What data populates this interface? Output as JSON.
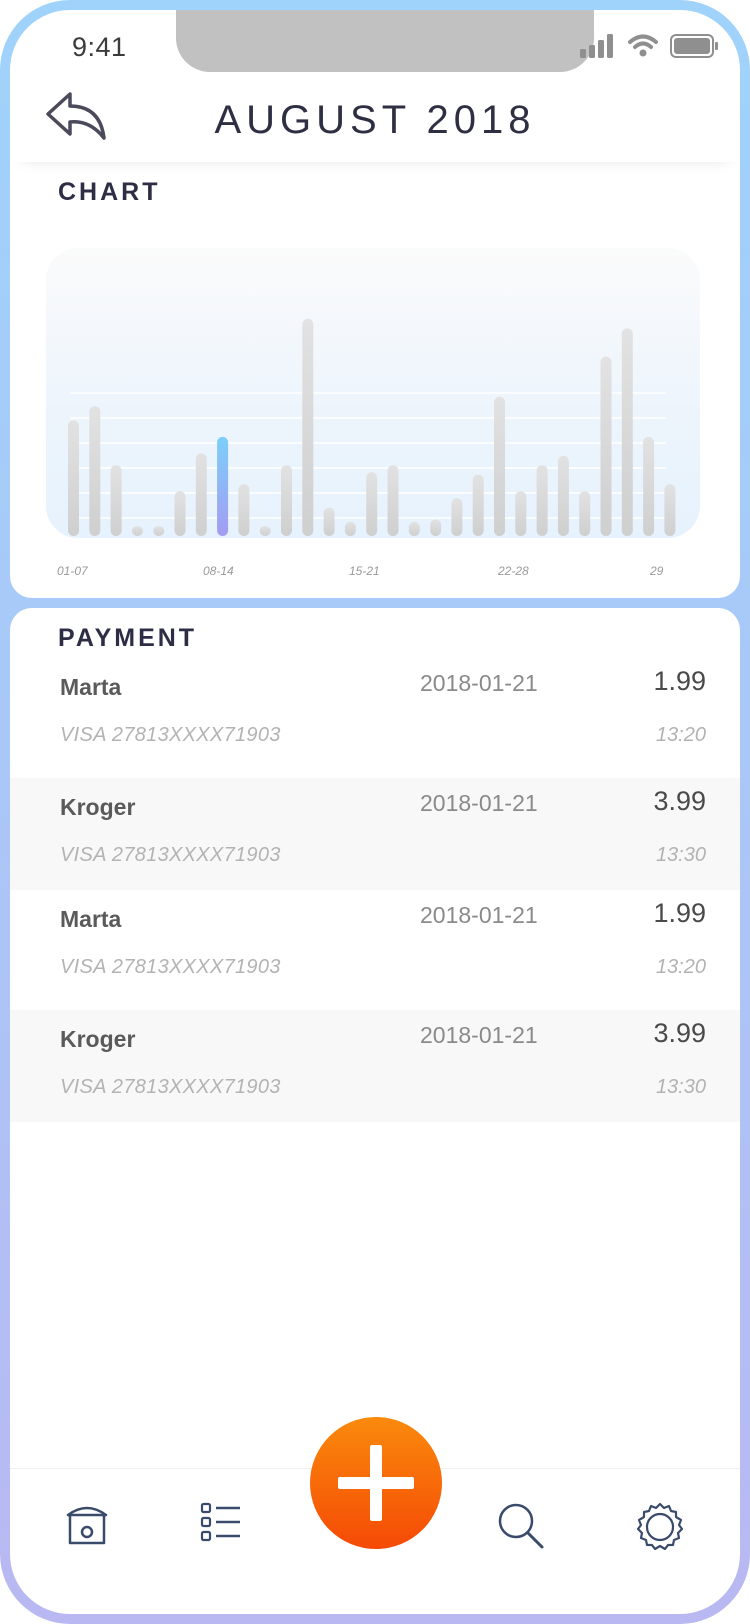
{
  "status_bar": {
    "time": "9:41",
    "signal_icon": "signal-icon",
    "wifi_icon": "wifi-icon",
    "battery_icon": "battery-icon"
  },
  "header": {
    "title": "AUGUST 2018",
    "back_icon": "back-arrow-icon"
  },
  "chart": {
    "section_title": "CHART",
    "highlight_color": "#7ccff9",
    "bar_color": "#d6d6d6"
  },
  "chart_data": {
    "type": "bar",
    "title": "",
    "x_ticks": [
      "01-07",
      "08-14",
      "15-21",
      "22-28",
      "29"
    ],
    "values": [
      49,
      55,
      30,
      3,
      4,
      19,
      35,
      42,
      22,
      4,
      30,
      92,
      12,
      6,
      27,
      30,
      6,
      7,
      16,
      26,
      59,
      19,
      30,
      34,
      19,
      76,
      88,
      42,
      22
    ],
    "highlight_index": 7,
    "grid": true
  },
  "payment": {
    "section_title": "PAYMENT",
    "items": [
      {
        "name": "Marta",
        "date": "2018-01-21",
        "amount": "1.99",
        "card": "VISA 27813XXXX71903",
        "time": "13:20"
      },
      {
        "name": "Kroger",
        "date": "2018-01-21",
        "amount": "3.99",
        "card": "VISA 27813XXXX71903",
        "time": "13:30"
      },
      {
        "name": "Marta",
        "date": "2018-01-21",
        "amount": "1.99",
        "card": "VISA 27813XXXX71903",
        "time": "13:20"
      },
      {
        "name": "Kroger",
        "date": "2018-01-21",
        "amount": "3.99",
        "card": "VISA 27813XXXX71903",
        "time": "13:30"
      }
    ]
  },
  "tabbar": {
    "home_icon": "home-icon",
    "list_icon": "list-icon",
    "add_icon": "plus-icon",
    "search_icon": "search-icon",
    "settings_icon": "gear-icon",
    "fab_color": "#f76a07"
  }
}
